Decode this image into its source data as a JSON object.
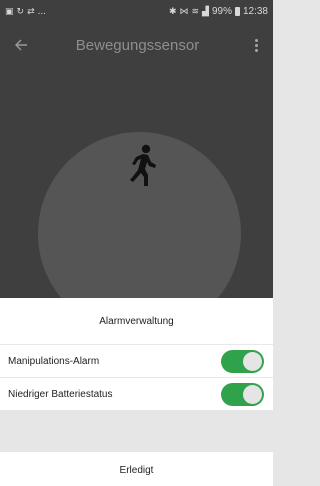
{
  "status_bar": {
    "left_icons": [
      "image-icon",
      "sync-icon",
      "sync-icon"
    ],
    "left_ellipsis": "...",
    "right_icons": [
      "bluetooth-icon",
      "vibrate-icon",
      "wifi-icon",
      "signal-icon"
    ],
    "battery": "99%",
    "time": "12:38"
  },
  "app_bar": {
    "title": "Bewegungssensor",
    "back_icon": "arrow-left-icon",
    "menu_icon": "more-vert-icon"
  },
  "sensor": {
    "icon": "running-person-icon"
  },
  "sheet": {
    "title": "Alarmverwaltung",
    "rows": [
      {
        "label": "Manipulations-Alarm",
        "enabled": true
      },
      {
        "label": "Niedriger Batteriestatus",
        "enabled": true
      }
    ],
    "done_label": "Erledigt"
  },
  "colors": {
    "background_dark": "#3f3f3f",
    "circle": "#555555",
    "toggle_on": "#31a24c",
    "sheet_bg": "#ffffff",
    "band": "#e6e6e6"
  }
}
